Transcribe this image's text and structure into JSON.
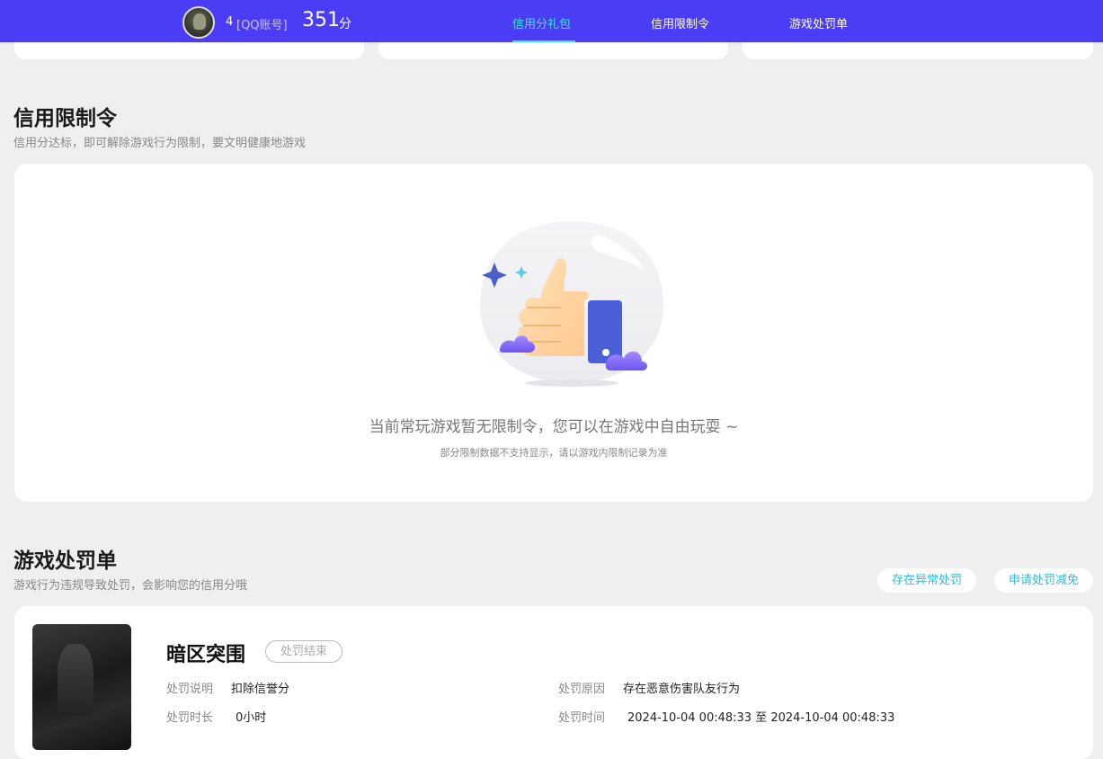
{
  "header": {
    "level": "4",
    "account_type": "[QQ账号]",
    "score": "351",
    "score_unit": "分",
    "nav": [
      {
        "label": "信用分礼包",
        "active": true
      },
      {
        "label": "信用限制令",
        "active": false
      },
      {
        "label": "游戏处罚单",
        "active": false
      }
    ]
  },
  "restriction": {
    "title": "信用限制令",
    "subtitle": "信用分达标，即可解除游戏行为限制，要文明健康地游戏",
    "empty_message": "当前常玩游戏暂无限制令，您可以在游戏中自由玩耍 ~",
    "empty_note": "部分限制数据不支持显示，请以游戏内限制记录为准"
  },
  "penalty": {
    "title": "游戏处罚单",
    "subtitle": "游戏行为违规导致处罚，会影响您的信用分哦",
    "btn_abnormal": "存在异常处罚",
    "btn_appeal": "申请处罚减免",
    "record": {
      "game": "暗区突围",
      "status": "处罚结束",
      "desc_label": "处罚说明",
      "desc_value": "扣除信誉分",
      "duration_label": "处罚时长",
      "duration_value": "0小时",
      "reason_label": "处罚原因",
      "reason_value": "存在恶意伤害队友行为",
      "time_label": "处罚时间",
      "time_value": "2024-10-04 00:48:33 至 2024-10-04 00:48:33"
    }
  },
  "colors": {
    "header_bg": "#4b3cf5",
    "nav_active": "#3fe6f2",
    "link": "#31b8d8"
  }
}
